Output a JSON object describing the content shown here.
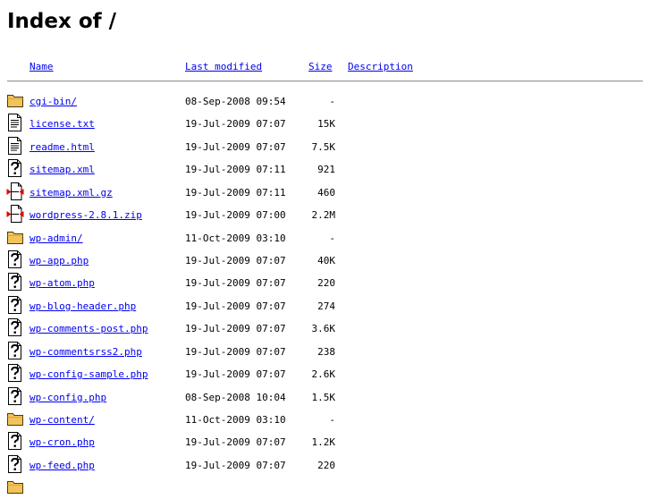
{
  "page": {
    "title": "Index of /"
  },
  "columns": {
    "name": "Name",
    "last_modified": "Last modified",
    "size": "Size",
    "description": "Description"
  },
  "entries": [
    {
      "icon": "folder-icon",
      "name": "cgi-bin/",
      "modified": "08-Sep-2008 09:54",
      "size": "-",
      "description": ""
    },
    {
      "icon": "text-file-icon",
      "name": "license.txt",
      "modified": "19-Jul-2009 07:07",
      "size": "15K",
      "description": ""
    },
    {
      "icon": "text-file-icon",
      "name": "readme.html",
      "modified": "19-Jul-2009 07:07",
      "size": "7.5K",
      "description": ""
    },
    {
      "icon": "unknown-file-icon",
      "name": "sitemap.xml",
      "modified": "19-Jul-2009 07:11",
      "size": "921",
      "description": ""
    },
    {
      "icon": "archive-file-icon",
      "name": "sitemap.xml.gz",
      "modified": "19-Jul-2009 07:11",
      "size": "460",
      "description": ""
    },
    {
      "icon": "archive-file-icon",
      "name": "wordpress-2.8.1.zip",
      "modified": "19-Jul-2009 07:00",
      "size": "2.2M",
      "description": ""
    },
    {
      "icon": "folder-icon",
      "name": "wp-admin/",
      "modified": "11-Oct-2009 03:10",
      "size": "-",
      "description": ""
    },
    {
      "icon": "unknown-file-icon",
      "name": "wp-app.php",
      "modified": "19-Jul-2009 07:07",
      "size": "40K",
      "description": ""
    },
    {
      "icon": "unknown-file-icon",
      "name": "wp-atom.php",
      "modified": "19-Jul-2009 07:07",
      "size": "220",
      "description": ""
    },
    {
      "icon": "unknown-file-icon",
      "name": "wp-blog-header.php",
      "modified": "19-Jul-2009 07:07",
      "size": "274",
      "description": ""
    },
    {
      "icon": "unknown-file-icon",
      "name": "wp-comments-post.php",
      "modified": "19-Jul-2009 07:07",
      "size": "3.6K",
      "description": ""
    },
    {
      "icon": "unknown-file-icon",
      "name": "wp-commentsrss2.php",
      "modified": "19-Jul-2009 07:07",
      "size": "238",
      "description": ""
    },
    {
      "icon": "unknown-file-icon",
      "name": "wp-config-sample.php",
      "modified": "19-Jul-2009 07:07",
      "size": "2.6K",
      "description": ""
    },
    {
      "icon": "unknown-file-icon",
      "name": "wp-config.php",
      "modified": "08-Sep-2008 10:04",
      "size": "1.5K",
      "description": ""
    },
    {
      "icon": "folder-icon",
      "name": "wp-content/",
      "modified": "11-Oct-2009 03:10",
      "size": "-",
      "description": ""
    },
    {
      "icon": "unknown-file-icon",
      "name": "wp-cron.php",
      "modified": "19-Jul-2009 07:07",
      "size": "1.2K",
      "description": ""
    },
    {
      "icon": "unknown-file-icon",
      "name": "wp-feed.php",
      "modified": "19-Jul-2009 07:07",
      "size": "220",
      "description": ""
    },
    {
      "icon": "folder-icon",
      "name": "",
      "modified": "",
      "size": "",
      "description": ""
    }
  ]
}
